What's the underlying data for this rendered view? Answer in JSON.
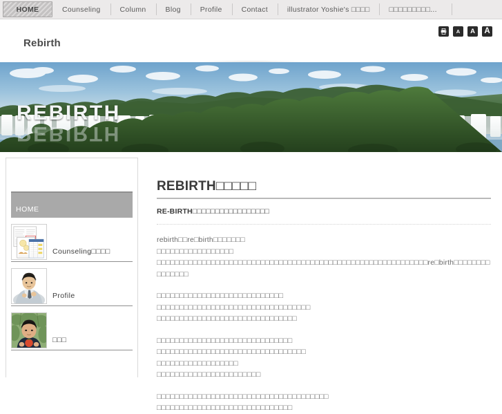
{
  "nav": {
    "items": [
      {
        "label": "HOME",
        "active": true
      },
      {
        "label": "Counseling",
        "active": false
      },
      {
        "label": "Column",
        "active": false
      },
      {
        "label": "Blog",
        "active": false
      },
      {
        "label": "Profile",
        "active": false
      },
      {
        "label": "Contact",
        "active": false
      },
      {
        "label": "illustrator Yoshie's □□□□",
        "active": false
      },
      {
        "label": "□□□□□□□□□...",
        "active": false
      }
    ]
  },
  "header": {
    "site_title": "Rebirth",
    "tools": {
      "print_label": "",
      "font_small": "A",
      "font_medium": "A",
      "font_large": "A"
    }
  },
  "hero": {
    "wordmark": "REBIRTH",
    "wordmark_reflection": "REBIRTH",
    "accent_sky": "#8fb9d6",
    "accent_forest": "#3f6b32"
  },
  "sidebar": {
    "home_label": "HOME",
    "entries": [
      {
        "label": "Counseling□□□□",
        "thumb": "documents-thumbnail-icon"
      },
      {
        "label": "Profile",
        "thumb": "portrait-illustration-icon"
      },
      {
        "label": "□□□",
        "thumb": "portrait-photo-icon"
      }
    ]
  },
  "main": {
    "title": "REBIRTH□□□□□",
    "subtitle": "RE-BIRTH□□□□□□□□□□□□□□□□□",
    "paragraphs": [
      "rebirth□□re□birth□□□□□□□\n□□□□□□□□□□□□□□□□□\n□□□□□□□□□□□□□□□□□□□□□□□□□□□□□□□□□□□□□□□□□□□□□□□□□□□□□□□□□□□□re□birth□□□□□□□□□□□□□□□",
      "□□□□□□□□□□□□□□□□□□□□□□□□□□□□\n□□□□□□□□□□□□□□□□□□□□□□□□□□□□□□□□□□\n□□□□□□□□□□□□□□□□□□□□□□□□□□□□□□□",
      "□□□□□□□□□□□□□□□□□□□□□□□□□□□□□□\n□□□□□□□□□□□□□□□□□□□□□□□□□□□□□□□□□\n□□□□□□□□□□□□□□□□□□\n□□□□□□□□□□□□□□□□□□□□□□□",
      "□□□□□□□□□□□□□□□□□□□□□□□□□□□□□□□□□□□□□□\n□□□□□□□□□□□□□□□□□□□□□□□□□□□□□□"
    ]
  },
  "colors": {
    "nav_bg": "#eceaea",
    "nav_active_bg": "#c4c2c2",
    "sidebar_home_bg": "#a9a9a9",
    "text_body": "#6a6a6a",
    "text_heading": "#3a3a3a",
    "tool_btn_bg": "#2b2b2b"
  }
}
